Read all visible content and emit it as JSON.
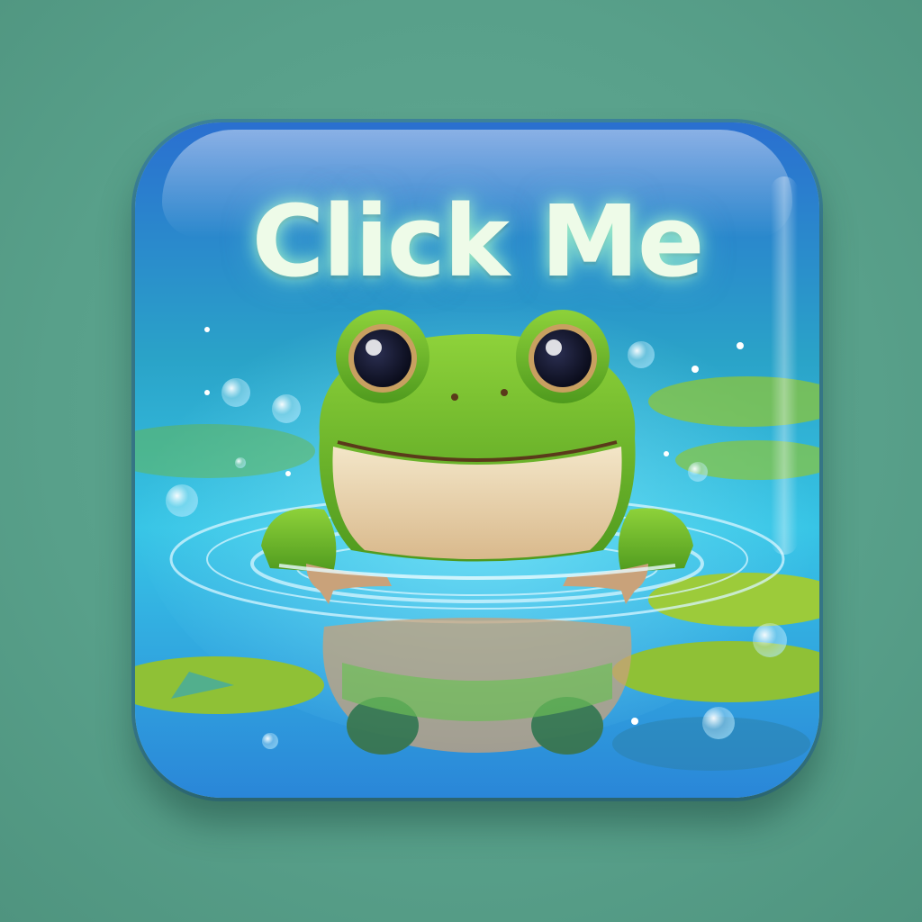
{
  "button": {
    "label": "Click Me",
    "icon": "frog-icon"
  },
  "colors": {
    "background": "#5aa08c",
    "button_top": "#2f7fd6",
    "button_bottom": "#3fc7e0",
    "label": "#eefbe8",
    "frog_green": "#7cc52a",
    "lily_pad": "#8cc63a"
  }
}
